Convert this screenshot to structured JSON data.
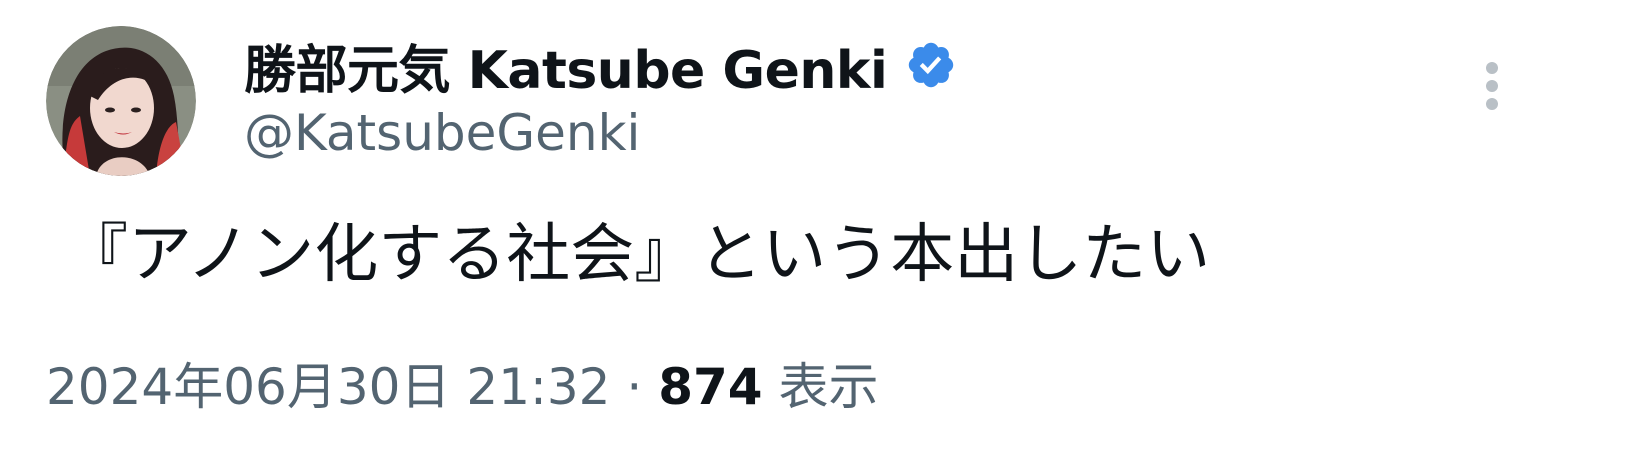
{
  "author": {
    "display_name": "勝部元気 Katsube Genki",
    "handle": "@KatsubeGenki",
    "verified": true
  },
  "tweet": {
    "text": "『アノン化する社会』という本出したい",
    "timestamp": "2024年06月30日 21:32",
    "separator": "·",
    "views_count": "874",
    "views_label": "表示"
  },
  "colors": {
    "verified_badge": "#3b8bea",
    "secondary_text": "#536471",
    "primary_text": "#0f1419",
    "more_icon": "#b9c0c6"
  },
  "icons": {
    "avatar": "avatar-photo",
    "verified": "verified-badge-icon",
    "more": "more-vertical-icon"
  }
}
